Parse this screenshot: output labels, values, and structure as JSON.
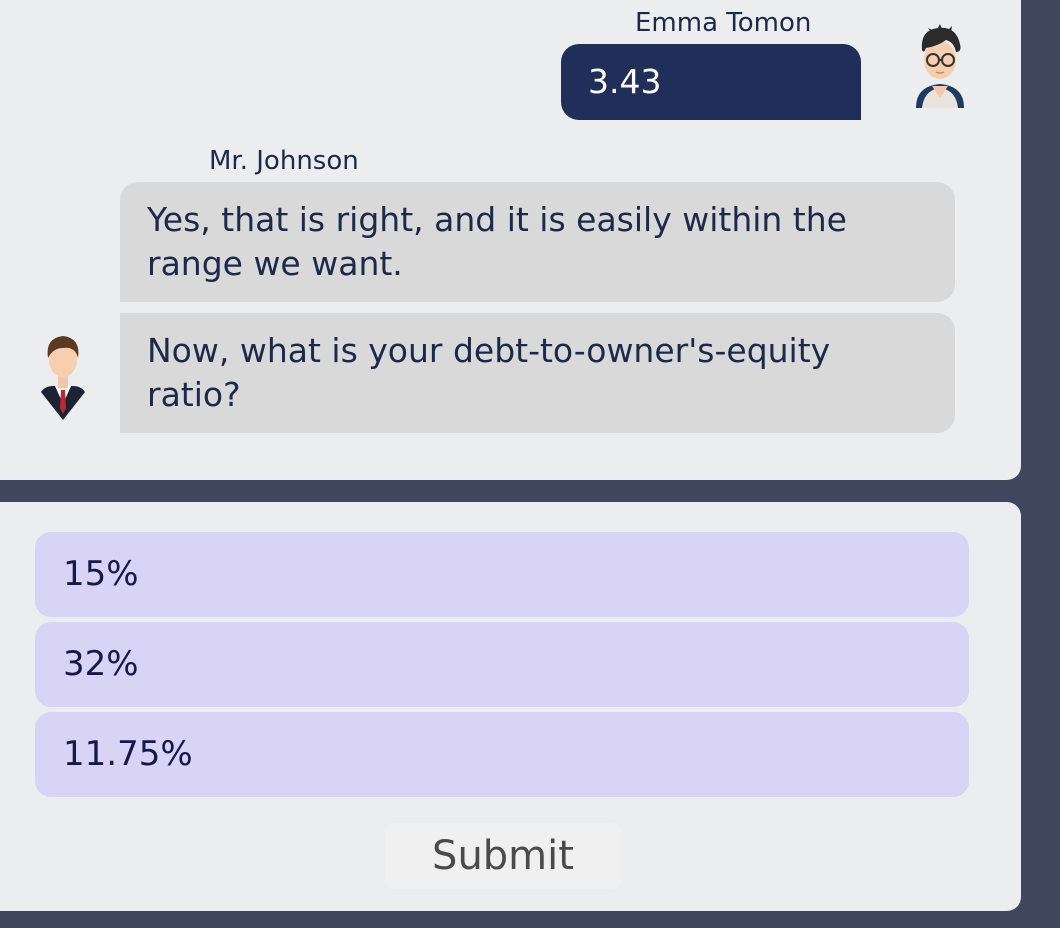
{
  "chat": {
    "user": {
      "name": "Emma Tomon",
      "message": "3.43",
      "avatar_icon": "student-avatar-icon"
    },
    "bot": {
      "name": "Mr. Johnson",
      "messages": [
        "Yes, that is right, and it is easily within the range we want.",
        "Now, what is your debt-to-owner's-equity ratio?"
      ],
      "avatar_icon": "businessman-avatar-icon"
    }
  },
  "answers": {
    "options": [
      "15%",
      "32%",
      "11.75%"
    ],
    "submit_label": "Submit"
  },
  "colors": {
    "background": "#3e475e",
    "panel": "#ecedef",
    "user_bubble": "#1f2f5a",
    "bot_bubble": "#d9d9d9",
    "option": "#d9d3f5"
  }
}
